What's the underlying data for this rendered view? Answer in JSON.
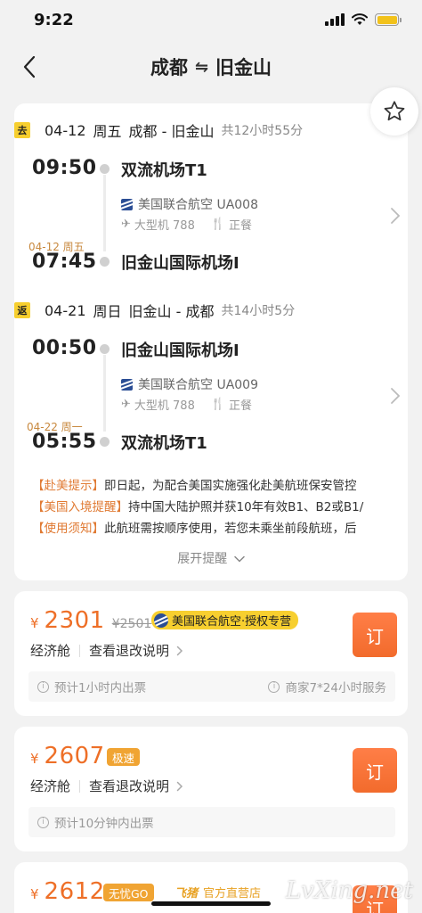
{
  "status": {
    "time": "9:22"
  },
  "nav": {
    "from": "成都",
    "swap": "⇋",
    "to": "旧金山"
  },
  "segments": [
    {
      "tag": "去",
      "date": "04-12",
      "weekday": "周五",
      "route": "成都 - 旧金山",
      "duration": "共12小时55分",
      "dep_time": "09:50",
      "dep_airport": "双流机场T1",
      "airline": "美国联合航空 UA008",
      "aircraft": "大型机 788",
      "meal": "正餐",
      "next_day": "04-12 周五",
      "arr_time": "07:45",
      "arr_airport": "旧金山国际机场I"
    },
    {
      "tag": "返",
      "date": "04-21",
      "weekday": "周日",
      "route": "旧金山 - 成都",
      "duration": "共14小时5分",
      "dep_time": "00:50",
      "dep_airport": "旧金山国际机场I",
      "airline": "美国联合航空 UA009",
      "aircraft": "大型机 788",
      "meal": "正餐",
      "next_day": "04-22 周一",
      "arr_time": "05:55",
      "arr_airport": "双流机场T1"
    }
  ],
  "notices": [
    {
      "tag": "【赴美提示】",
      "text": "即日起，为配合美国实施强化赴美航班保安管控"
    },
    {
      "tag": "【美国入境提醒】",
      "text": "持中国大陆护照并获10年有效B1、B2或B1/"
    },
    {
      "tag": "【使用须知】",
      "text": "此航班需按顺序使用，若您未乘坐前段航班，后"
    }
  ],
  "expand_label": "展开提醒",
  "offers": [
    {
      "yen": "¥",
      "price": "2301",
      "orig_price": "¥2501",
      "badge": "美国联合航空·授权专营",
      "cabin": "经济舱",
      "rule": "查看退改说明",
      "book": "订",
      "info_left": "预计1小时内出票",
      "info_right": "商家7*24小时服务"
    },
    {
      "yen": "¥",
      "price": "2607",
      "badge": "极速",
      "cabin": "经济舱",
      "rule": "查看退改说明",
      "book": "订",
      "info_left": "预计10分钟内出票"
    },
    {
      "yen": "¥",
      "price": "2612",
      "badge": "无忧GO",
      "brand": "飞猪",
      "brand_text": "官方直营店",
      "book": "订"
    }
  ],
  "watermark": "LvXing.net",
  "colors": {
    "accent": "#ee6f27",
    "tag_yellow": "#f7cf2f",
    "airline_blue": "#2a4d94"
  }
}
